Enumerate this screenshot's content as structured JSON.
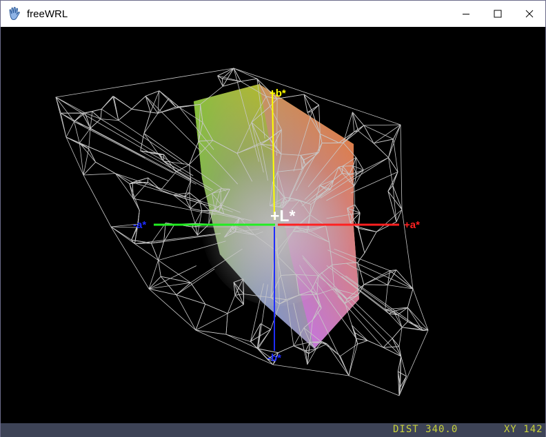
{
  "window": {
    "title": "freeWRL",
    "icon": "freewrl-hand-icon",
    "controls": [
      "minimize-icon",
      "maximize-icon",
      "close-icon"
    ]
  },
  "scene": {
    "axis_labels": {
      "b_plus": "+b*",
      "b_minus": "-b*",
      "a_plus": "+a*",
      "a_minus": "-a*",
      "L": "+L*"
    },
    "axis_colors": {
      "b": "#ffff00",
      "a_plus": "#ff0000",
      "a_minus": "#00ff00",
      "b_minus": "#1e2cff",
      "L": "#ffffff"
    },
    "background": "#000000",
    "wireframe_color": "#c8c8c8"
  },
  "status": {
    "dist": "DIST 340.0",
    "xy": "XY 142"
  }
}
